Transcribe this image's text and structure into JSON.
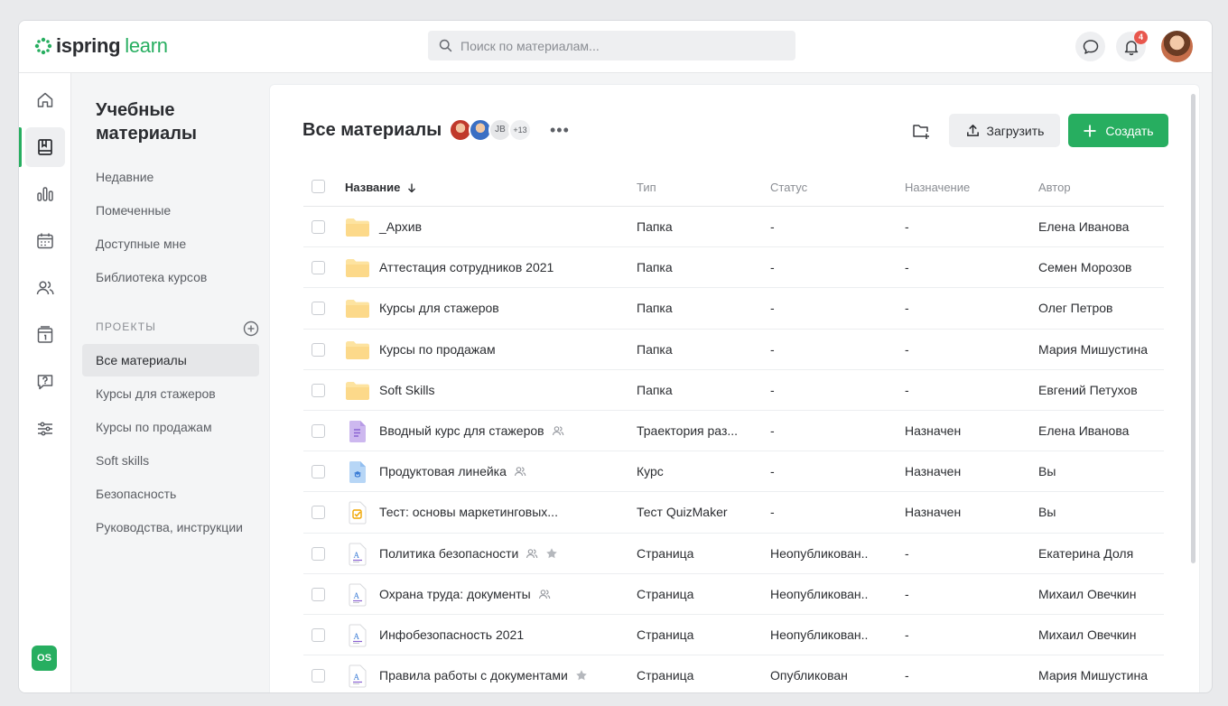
{
  "brand": {
    "word1": "ispring",
    "word2": "learn",
    "accent": "#27ae60"
  },
  "search": {
    "placeholder": "Поиск по материалам..."
  },
  "header": {
    "notifications_count": "4"
  },
  "rail": {
    "items": [
      {
        "name": "home-icon"
      },
      {
        "name": "book-icon"
      },
      {
        "name": "chart-icon"
      },
      {
        "name": "calendar-icon"
      },
      {
        "name": "users-icon"
      },
      {
        "name": "schedule-icon"
      },
      {
        "name": "question-icon"
      },
      {
        "name": "settings-sliders-icon"
      }
    ],
    "user_initials": "OS"
  },
  "sidebar": {
    "title": "Учебные материалы",
    "links": [
      "Недавние",
      "Помеченные",
      "Доступные мне",
      "Библиотека курсов"
    ],
    "section_label": "ПРОЕКТЫ",
    "projects": [
      "Все материалы",
      "Курсы для стажеров",
      "Курсы по продажам",
      "Soft skills",
      "Безопасность",
      "Руководства, инструкции"
    ]
  },
  "main": {
    "title": "Все материалы",
    "avatars_extra": [
      "JB",
      "+13"
    ],
    "upload_label": "Загрузить",
    "create_label": "Создать",
    "columns": {
      "name": "Название",
      "type": "Тип",
      "status": "Статус",
      "assign": "Назначение",
      "author": "Автор"
    },
    "rows": [
      {
        "icon": "folder",
        "name": "_Архив",
        "type": "Папка",
        "status": "-",
        "assign": "-",
        "author": "Елена Иванова"
      },
      {
        "icon": "folder",
        "name": "Аттестация сотрудников 2021",
        "type": "Папка",
        "status": "-",
        "assign": "-",
        "author": "Семен Морозов"
      },
      {
        "icon": "folder",
        "name": "Курсы для стажеров",
        "type": "Папка",
        "status": "-",
        "assign": "-",
        "author": "Олег Петров"
      },
      {
        "icon": "folder",
        "name": "Курсы по продажам",
        "type": "Папка",
        "status": "-",
        "assign": "-",
        "author": "Мария Мишустина"
      },
      {
        "icon": "folder",
        "name": "Soft Skills",
        "type": "Папка",
        "status": "-",
        "assign": "-",
        "author": "Евгений Петухов"
      },
      {
        "icon": "trajectory",
        "name": "Вводный курс для стажеров",
        "shared": true,
        "type": "Траектория раз...",
        "status": "-",
        "assign": "Назначен",
        "author": "Елена Иванова"
      },
      {
        "icon": "course",
        "name": "Продуктовая линейка",
        "shared": true,
        "type": "Курс",
        "status": "-",
        "assign": "Назначен",
        "author": "Вы"
      },
      {
        "icon": "quiz",
        "name": "Тест: основы маркетинговых...",
        "type": "Тест QuizMaker",
        "status": "-",
        "assign": "Назначен",
        "author": "Вы"
      },
      {
        "icon": "page",
        "name": "Политика безопасности",
        "shared": true,
        "starred": true,
        "type": "Страница",
        "status": "Неопубликован..",
        "assign": "-",
        "author": "Екатерина Доля"
      },
      {
        "icon": "page",
        "name": "Охрана труда: документы",
        "shared": true,
        "type": "Страница",
        "status": "Неопубликован..",
        "assign": "-",
        "author": "Михаил Овечкин"
      },
      {
        "icon": "page",
        "name": "Инфобезопасность 2021",
        "type": "Страница",
        "status": "Неопубликован..",
        "assign": "-",
        "author": "Михаил Овечкин"
      },
      {
        "icon": "page",
        "name": "Правила работы с документами",
        "starred": true,
        "type": "Страница",
        "status": "Опубликован",
        "assign": "-",
        "author": "Мария Мишустина"
      }
    ]
  }
}
